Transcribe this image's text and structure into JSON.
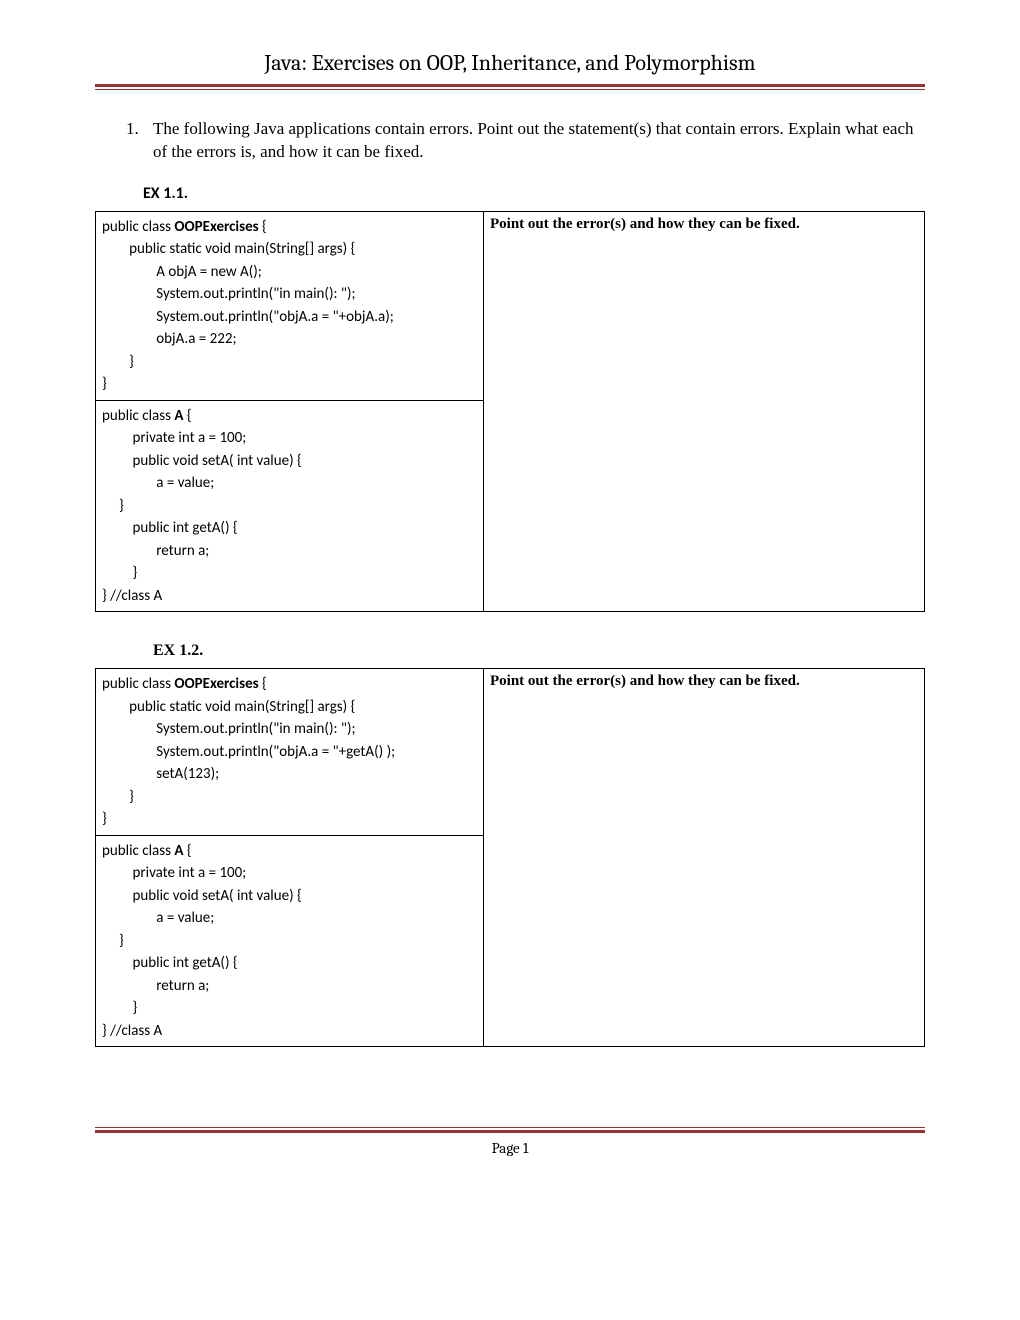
{
  "header": {
    "title": "Java:  Exercises on OOP, Inheritance, and Polymorphism"
  },
  "question": {
    "text": "The following Java applications contain errors. Point out the statement(s) that contain errors. Explain what each of the errors is, and how it can be fixed."
  },
  "ex11": {
    "label": "EX 1.1.",
    "answer_header": "Point out the error(s) and how they can be fixed.",
    "code_upper_pre": "public class ",
    "code_upper_class": "OOPExercises",
    "code_upper_post": " {\n        public static void main(String[] args) {\n                A objA = new A();\n                System.out.println(\"in main(): \");\n                System.out.println(\"objA.a = \"+objA.a);\n                objA.a = 222;\n        }\n}",
    "code_lower_pre": "public class ",
    "code_lower_class": "A",
    "code_lower_post": " {\n         private int a = 100;\n         public void setA( int value) {\n                a = value;\n     }\n         public int getA() {\n                return a;\n         }\n} //class A"
  },
  "ex12": {
    "label": "EX 1.2.",
    "answer_header": "Point out the error(s) and how they can be fixed.",
    "code_upper_pre": "public class ",
    "code_upper_class": "OOPExercises",
    "code_upper_post": " {\n        public static void main(String[] args) {\n                System.out.println(\"in main(): \");\n                System.out.println(\"objA.a = \"+getA() );\n                setA(123);\n        }\n}",
    "code_lower_pre": "public class ",
    "code_lower_class": "A",
    "code_lower_post": " {\n         private int a = 100;\n         public void setA( int value) {\n                a = value;\n     }\n         public int getA() {\n                return a;\n         }\n} //class A"
  },
  "footer": {
    "label": "Page ",
    "number": "1"
  }
}
